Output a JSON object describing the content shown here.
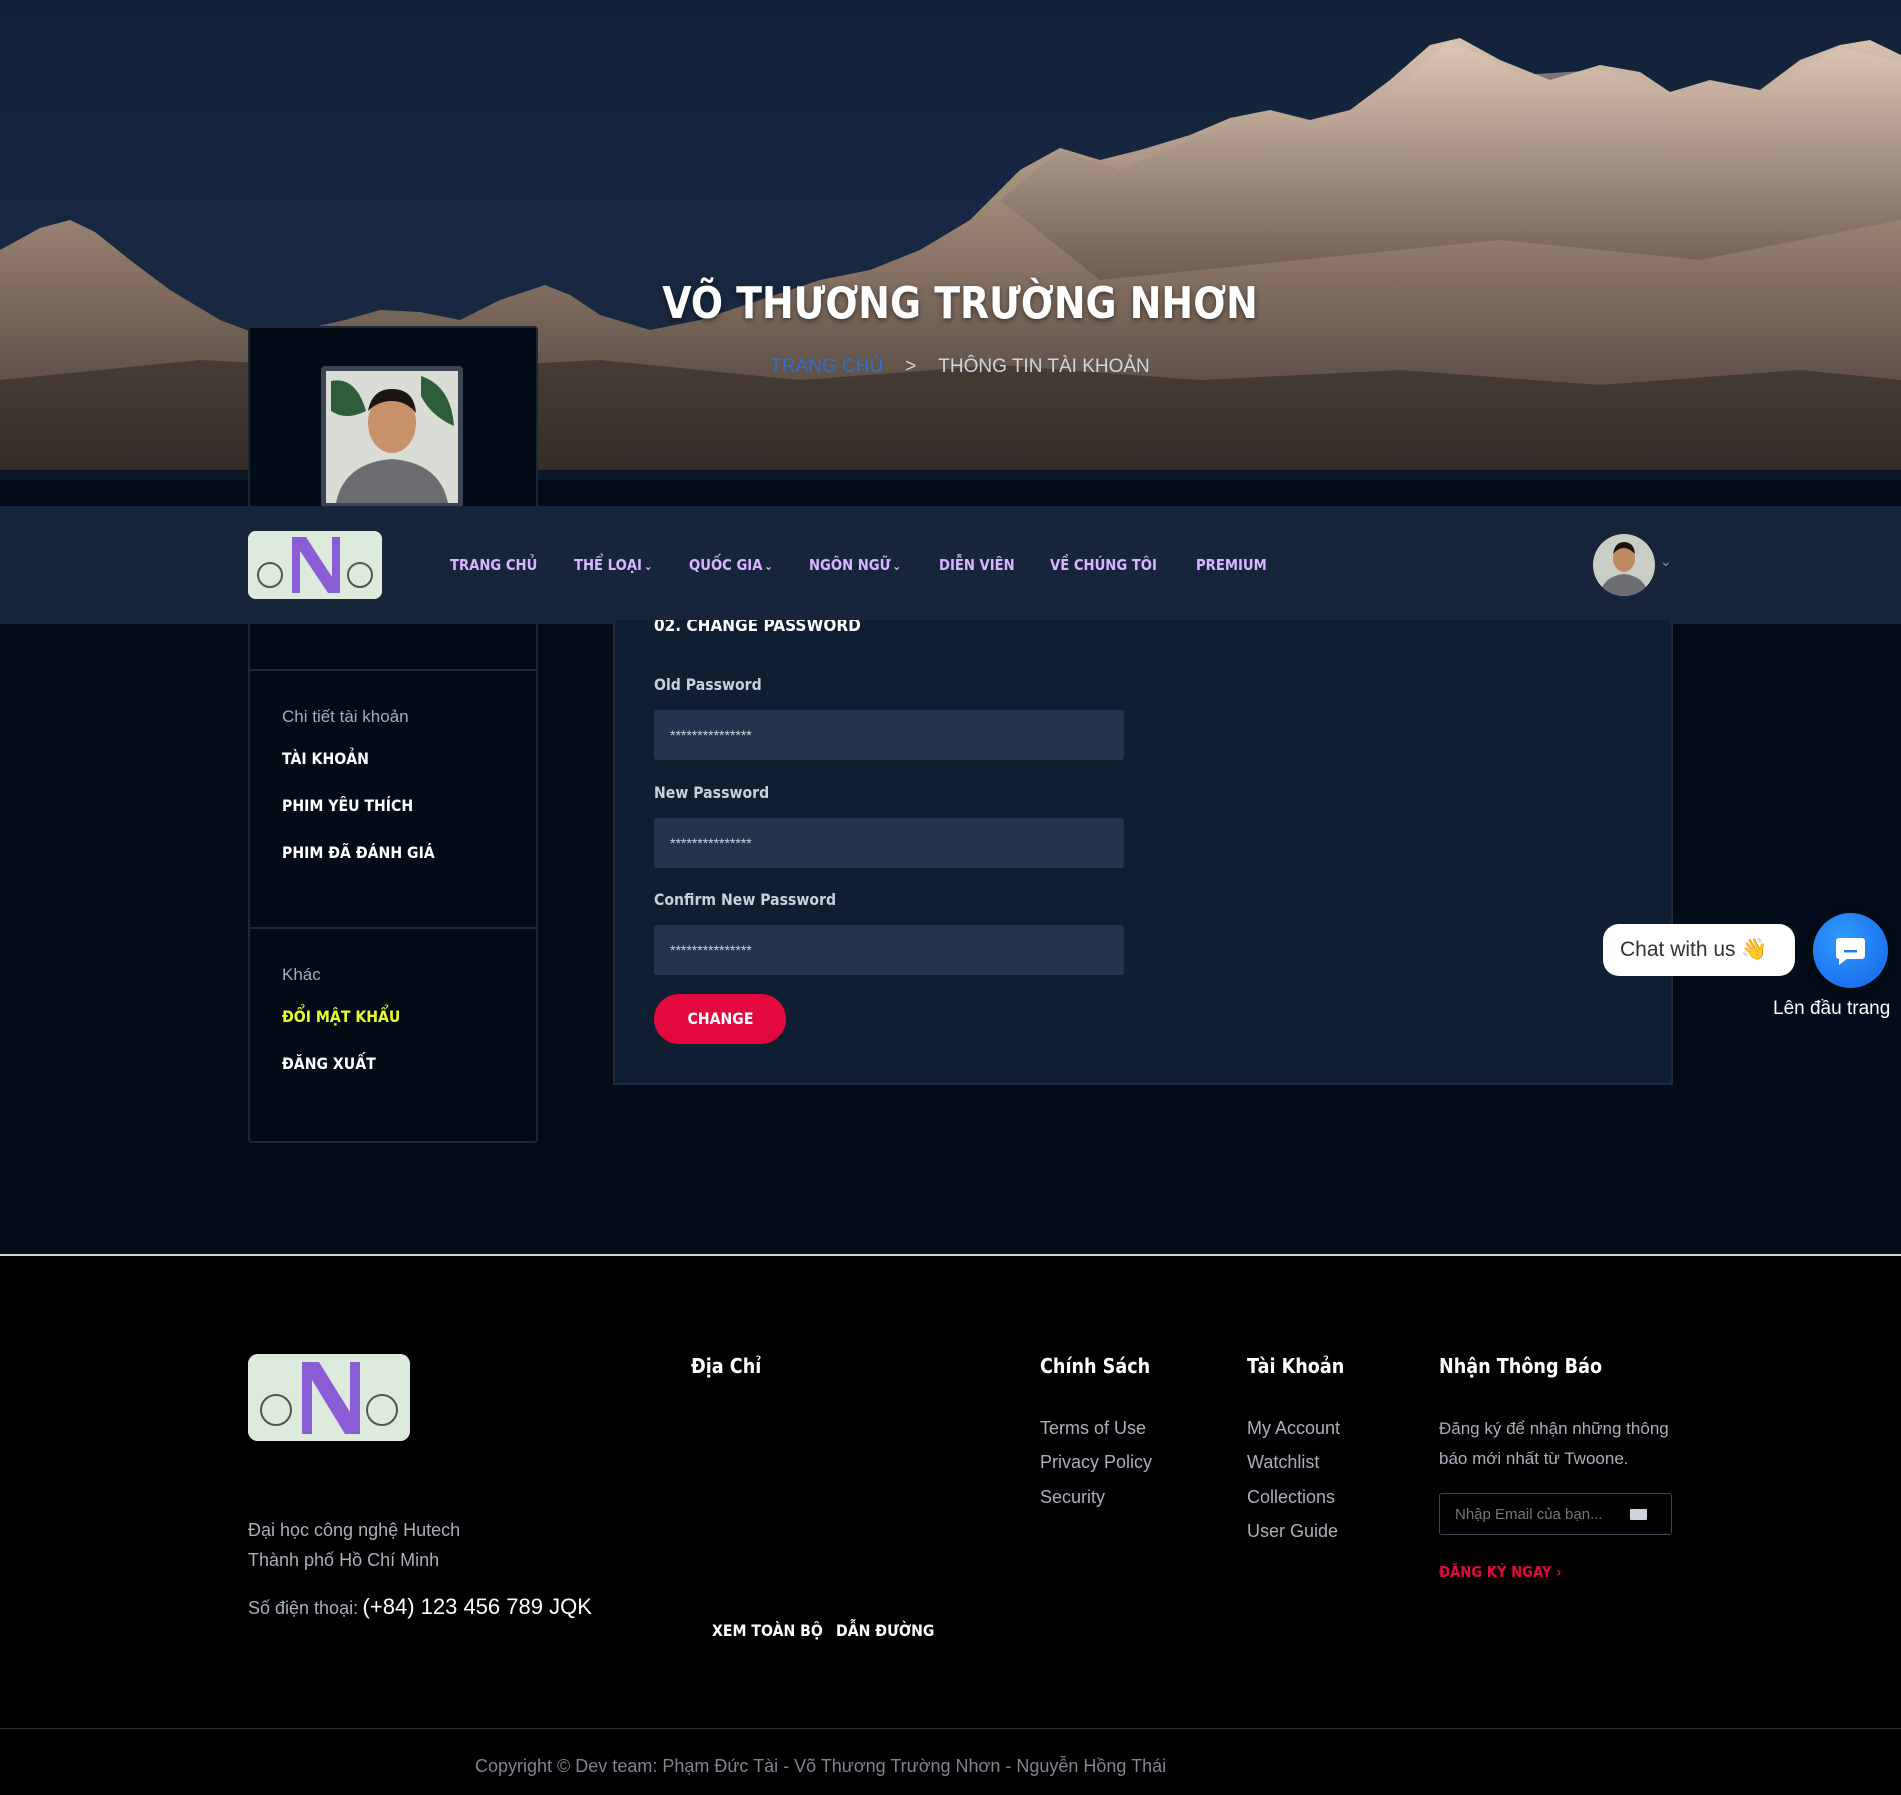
{
  "hero": {
    "title": "VÕ THƯƠNG TRƯỜNG NHƠN",
    "breadcrumb_home": "TRANG CHỦ",
    "breadcrumb_sep": ">",
    "breadcrumb_current": "THÔNG TIN TÀI KHOẢN"
  },
  "nav": {
    "items": [
      {
        "label": "TRANG CHỦ",
        "dropdown": false
      },
      {
        "label": "THỂ LOẠI",
        "dropdown": true
      },
      {
        "label": "QUỐC GIA",
        "dropdown": true
      },
      {
        "label": "NGÔN NGỮ",
        "dropdown": true
      },
      {
        "label": "DIỄN VIÊN",
        "dropdown": false
      },
      {
        "label": "VỀ CHÚNG TÔI",
        "dropdown": false
      },
      {
        "label": "PREMIUM",
        "dropdown": false
      }
    ],
    "caret": "⌄"
  },
  "sidebar": {
    "section1_heading": "Chi tiết tài khoản",
    "section1_links": [
      "TÀI KHOẢN",
      "PHIM YÊU THÍCH",
      "PHIM ĐÃ ĐÁNH GIÁ"
    ],
    "section2_heading": "Khác",
    "section2_links": [
      "ĐỔI MẬT KHẨU",
      "ĐĂNG XUẤT"
    ],
    "active_link": "ĐỔI MẬT KHẨU"
  },
  "form": {
    "title": "02. CHANGE PASSWORD",
    "old_label": "Old Password",
    "old_value": "***************",
    "new_label": "New Password",
    "new_value": "***************",
    "confirm_label": "Confirm New Password",
    "confirm_value": "***************",
    "submit_label": "CHANGE"
  },
  "chat": {
    "bubble_text": "Chat with us 👋",
    "to_top": "Lên đầu trang"
  },
  "footer": {
    "address_line1": "Đại học công nghệ Hutech",
    "address_line2": "Thành phố Hồ Chí Minh",
    "phone_label": "Số điện thoại:",
    "phone_value": "(+84) 123 456 789 JQK",
    "col_address_title": "Địa Chỉ",
    "view_all": "XEM TOÀN BỘ",
    "directions": "DẪN ĐƯỜNG",
    "col_policy_title": "Chính Sách",
    "policy_links": [
      "Terms of Use",
      "Privacy Policy",
      "Security"
    ],
    "col_account_title": "Tài Khoản",
    "account_links": [
      "My Account",
      "Watchlist",
      "Collections",
      "User Guide"
    ],
    "col_news_title": "Nhận Thông Báo",
    "news_line1": "Đăng ký để nhận những thông",
    "news_line2": "báo mới nhất từ Twoone.",
    "email_placeholder": "Nhập Email của bạn...",
    "subscribe_label": "ĐĂNG KÝ NGAY",
    "subscribe_arrow": "›",
    "copyright": "Copyright © Dev team: Phạm Đức Tài - Võ Thương Trường Nhơn - Nguyễn Hồng Thái"
  },
  "colors": {
    "accent_red": "#e3093f",
    "menu_purple": "#d7b6ff",
    "active_yellow": "#e5ff2b",
    "chat_blue": "#1a78f5"
  }
}
